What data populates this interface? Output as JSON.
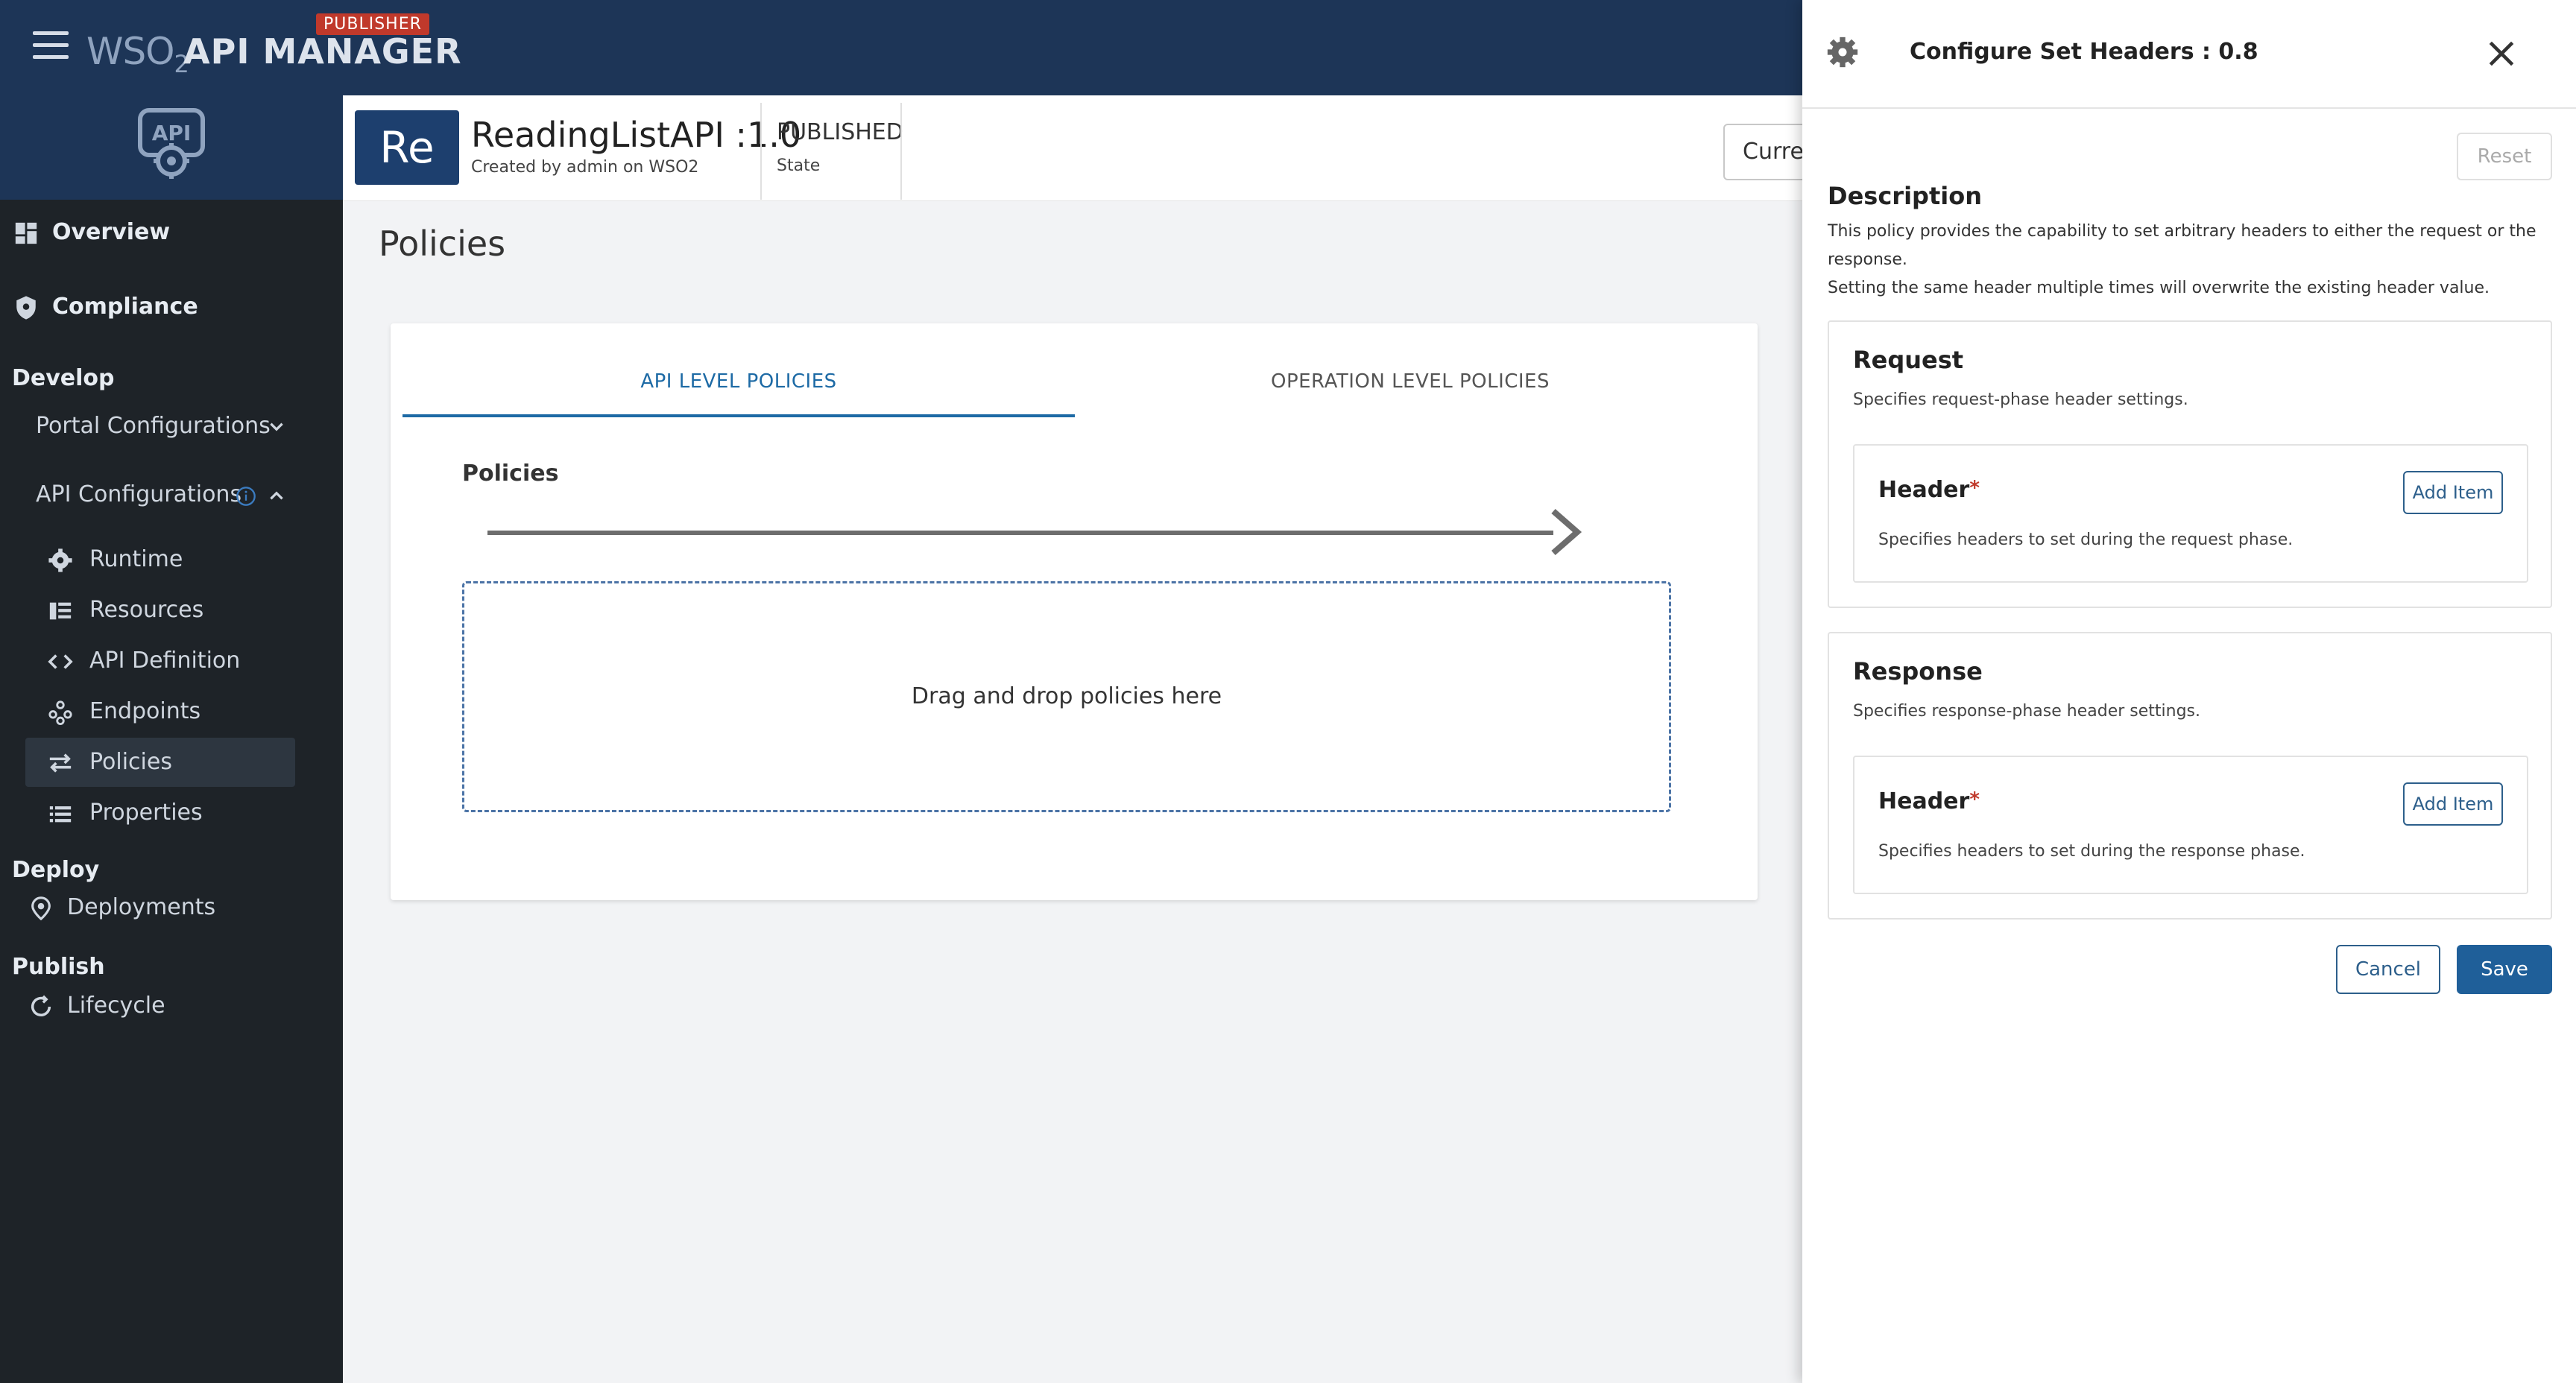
{
  "header": {
    "brand_wso": "WSO",
    "brand_wso_sub": "2",
    "brand_name": "API MANAGER",
    "publisher_badge": "PUBLISHER"
  },
  "sidebar": {
    "overview": "Overview",
    "compliance": "Compliance",
    "develop": "Develop",
    "portal_configurations": "Portal Configurations",
    "api_configurations": "API Configurations",
    "items": [
      {
        "label": "Runtime",
        "icon": "gear-icon"
      },
      {
        "label": "Resources",
        "icon": "resources-icon"
      },
      {
        "label": "API Definition",
        "icon": "code-icon"
      },
      {
        "label": "Endpoints",
        "icon": "endpoints-icon"
      },
      {
        "label": "Policies",
        "icon": "swap-icon"
      },
      {
        "label": "Properties",
        "icon": "list-icon"
      }
    ],
    "deploy": "Deploy",
    "deployments": "Deployments",
    "publish": "Publish",
    "lifecycle": "Lifecycle"
  },
  "api": {
    "avatar": "Re",
    "name": "ReadingListAPI :1.0",
    "created": "Created by admin on WSO2",
    "state": "PUBLISHED",
    "state_label": "State",
    "current_button": "Curren"
  },
  "main": {
    "page_title": "Policies",
    "tab_api": "API LEVEL POLICIES",
    "tab_operation": "OPERATION LEVEL POLICIES",
    "policies_label": "Policies",
    "dropzone": "Drag and drop policies here"
  },
  "drawer": {
    "title": "Configure Set Headers : 0.8",
    "reset": "Reset",
    "description_title": "Description",
    "description_line1": "This policy provides the capability to set arbitrary headers to either the request or the response.",
    "description_line2": "Setting the same header multiple times will overwrite the existing header value.",
    "request": {
      "title": "Request",
      "subtitle": "Specifies request-phase header settings.",
      "header_label": "Header",
      "required_mark": "*",
      "header_sub": "Specifies headers to set during the request phase.",
      "add_item": "Add Item"
    },
    "response": {
      "title": "Response",
      "subtitle": "Specifies response-phase header settings.",
      "header_label": "Header",
      "required_mark": "*",
      "header_sub": "Specifies headers to set during the response phase.",
      "add_item": "Add Item"
    },
    "cancel": "Cancel",
    "save": "Save"
  },
  "colors": {
    "header_bg": "#1d3557",
    "sidebar_bg": "#1e2328",
    "accent": "#1f5f99",
    "required": "#c0392b"
  }
}
